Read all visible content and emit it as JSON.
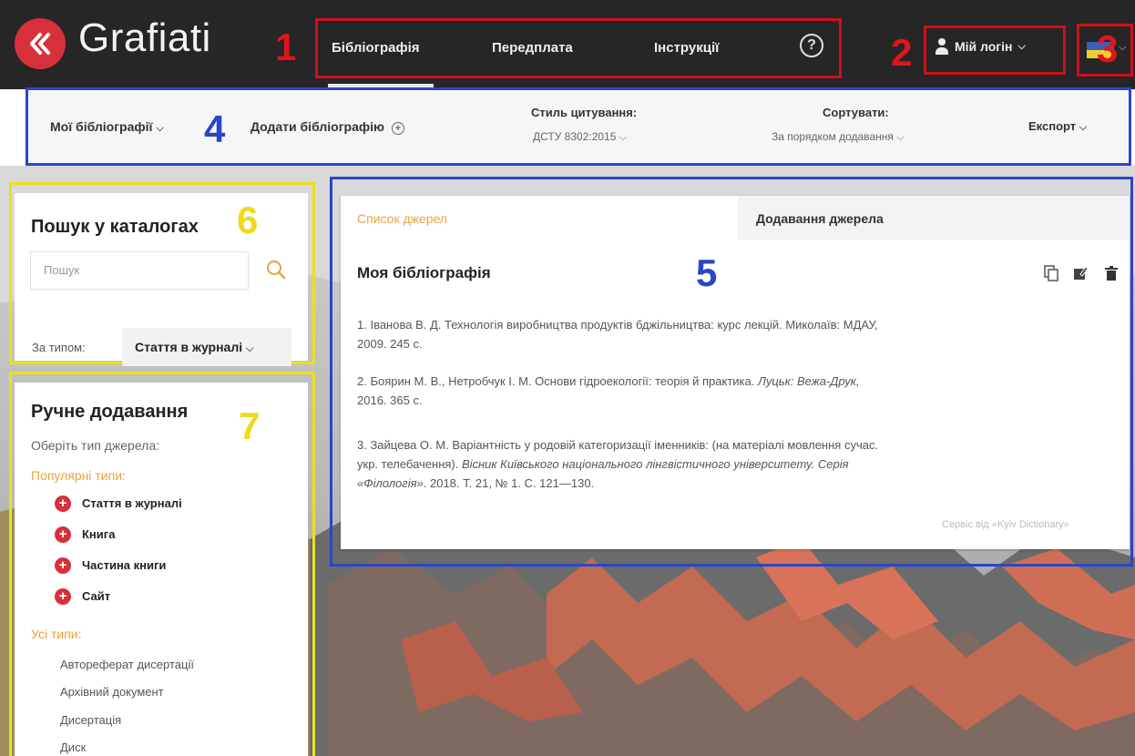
{
  "header": {
    "logo_text": "Grafiati",
    "nav": [
      "Бібліографія",
      "Передплата",
      "Інструкції"
    ],
    "help_icon": "question-circle-icon",
    "login_label": "Мій логін"
  },
  "annotations": {
    "n1": "1",
    "n2": "2",
    "n3": "3",
    "n4": "4",
    "n5": "5",
    "n6": "6",
    "n7": "7"
  },
  "toolbar": {
    "my_bibliographies": "Мої бібліографії",
    "add_bibliography": "Додати бібліографію",
    "citation_style_label": "Стиль цитування:",
    "citation_style_value": "ДСТУ 8302:2015",
    "sort_label": "Сортувати:",
    "sort_value": "За порядком додавання",
    "export": "Експорт"
  },
  "catalog_search": {
    "title": "Пошук у каталогах",
    "placeholder": "Пошук",
    "type_label": "За типом:",
    "type_value": "Стаття в журналі"
  },
  "manual_add": {
    "title": "Ручне додавання",
    "subtitle": "Оберіть тип джерела:",
    "popular_label": "Популярні типи:",
    "popular": [
      "Стаття в журналі",
      "Книга",
      "Частина книги",
      "Сайт"
    ],
    "all_label": "Усі типи:",
    "all": [
      "Автореферат дисертації",
      "Архівний документ",
      "Дисертація",
      "Диск"
    ]
  },
  "main": {
    "tab_sources": "Список джерел",
    "tab_add": "Додавання джерела",
    "title": "Моя бібліографія",
    "entries": [
      {
        "a": "1. Іванова В. Д. Технологія виробництва продуктів бджільництва: курс лекцій. Миколаїв: МДАУ,",
        "b": "2009. 245 с."
      },
      {
        "a": "2. Боярин М. В., Нетробчук І. М. Основи гідроекології: теорія й практика. ",
        "a_italic": "Луцьк: Вежа-Друк,",
        "b": "2016. 365 с."
      },
      {
        "a": "3. Зайцева О. М. Варіантність у родовій категоризації іменників: (на матеріалі мовлення сучас.",
        "b": "укр. телебачення). ",
        "b_italic": "Вісник Київського національного лінгвістичного університету. Серія",
        "c_italic": "«Філологія»",
        "c": ". 2018. Т. 21, № 1. С. 121—130."
      }
    ],
    "footer": "Сервіс від «Kyiv Dictionary»"
  },
  "colors": {
    "accent_red": "#d8303a",
    "header_bg": "#262626",
    "annotation_blue": "#2b46c9",
    "annotation_yellow": "#e8e21a",
    "popular_orange": "#e9a23b"
  }
}
